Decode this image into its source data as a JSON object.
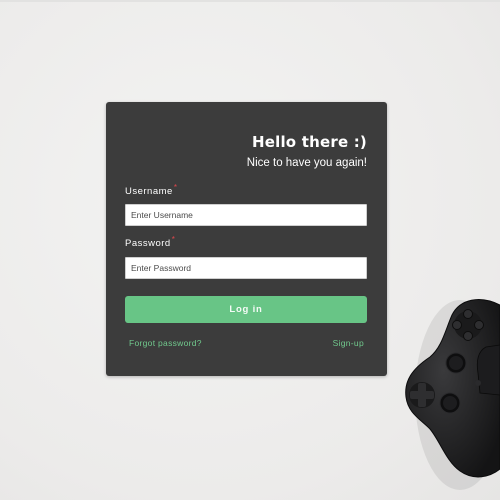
{
  "login": {
    "title": "Hello there :)",
    "subtitle": "Nice to have you again!",
    "username": {
      "label": "Username",
      "required_mark": "*",
      "placeholder": "Enter Username"
    },
    "password": {
      "label": "Password",
      "required_mark": "*",
      "placeholder": "Enter Password"
    },
    "login_button": "Log in",
    "forgot_link": "Forgot password?",
    "signup_link": "Sign-up"
  },
  "colors": {
    "card_background": "#3c3c3c",
    "accent_green": "#68c586",
    "link_green": "#71c98d",
    "required_red": "#e0474c",
    "page_background": "#eeeeed"
  },
  "decor": {
    "controller_icon": "gamepad-icon"
  }
}
